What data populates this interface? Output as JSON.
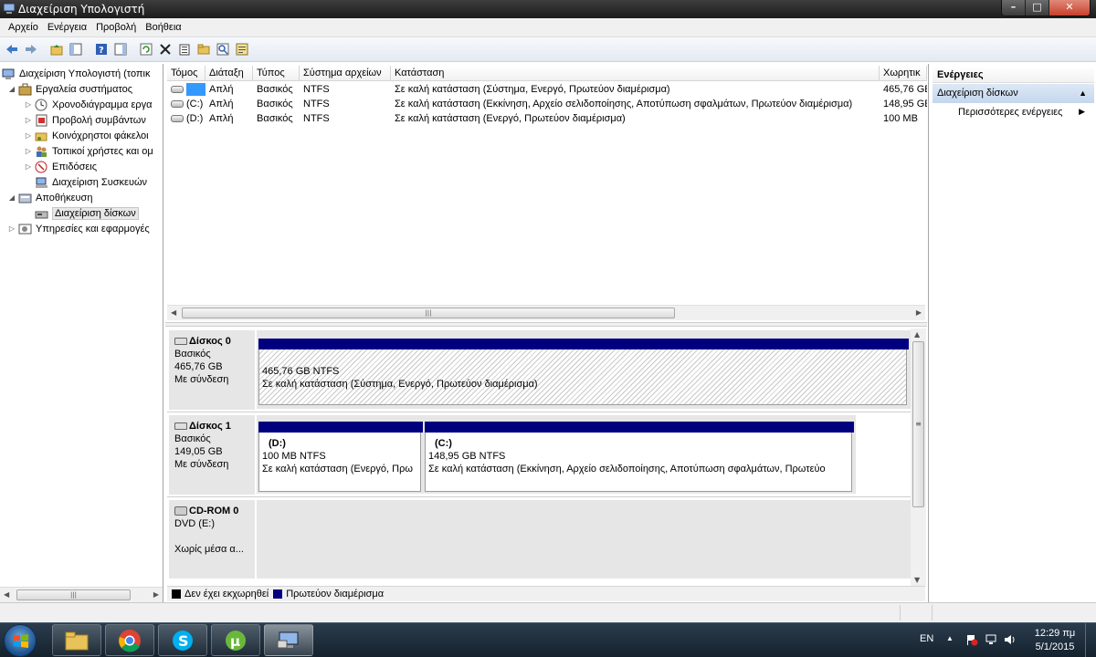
{
  "window": {
    "title": "Διαχείριση Υπολογιστή",
    "min": "–",
    "max": "□",
    "close": "✕"
  },
  "menu": [
    "Αρχείο",
    "Ενέργεια",
    "Προβολή",
    "Βοήθεια"
  ],
  "tree": {
    "root": "Διαχείριση Υπολογιστή (τοπικ",
    "system_tools": "Εργαλεία συστήματος",
    "task_scheduler": "Χρονοδιάγραμμα εργα",
    "event_viewer": "Προβολή συμβάντων",
    "shared_folders": "Κοινόχρηστοι φάκελοι",
    "local_users": "Τοπικοί χρήστες και ομ",
    "performance": "Επιδόσεις",
    "device_manager": "Διαχείριση Συσκευών",
    "storage": "Αποθήκευση",
    "disk_management": "Διαχείριση δίσκων",
    "services": "Υπηρεσίες και εφαρμογές"
  },
  "volume_list": {
    "headers": [
      "Τόμος",
      "Διάταξη",
      "Τύπος",
      "Σύστημα αρχείων",
      "Κατάσταση",
      "Χωρητικ"
    ],
    "rows": [
      {
        "volume": "",
        "layout": "Απλή",
        "type": "Βασικός",
        "fs": "NTFS",
        "status": "Σε καλή κατάσταση (Σύστημα, Ενεργό, Πρωτεύον διαμέρισμα)",
        "capacity": "465,76 GE"
      },
      {
        "volume": "(C:)",
        "layout": "Απλή",
        "type": "Βασικός",
        "fs": "NTFS",
        "status": "Σε καλή κατάσταση (Εκκίνηση, Αρχείο σελιδοποίησης, Αποτύπωση σφαλμάτων, Πρωτεύον διαμέρισμα)",
        "capacity": "148,95 GE"
      },
      {
        "volume": "(D:)",
        "layout": "Απλή",
        "type": "Βασικός",
        "fs": "NTFS",
        "status": "Σε καλή κατάσταση (Ενεργό, Πρωτεύον διαμέρισμα)",
        "capacity": "100 MB"
      }
    ]
  },
  "disks": [
    {
      "name": "Δίσκος 0",
      "type": "Βασικός",
      "size": "465,76 GB",
      "state": "Με σύνδεση",
      "partitions": [
        {
          "label": "",
          "size": "465,76 GB NTFS",
          "status": "Σε καλή κατάσταση (Σύστημα, Ενεργό, Πρωτεύον διαμέρισμα)"
        }
      ]
    },
    {
      "name": "Δίσκος 1",
      "type": "Βασικός",
      "size": "149,05 GB",
      "state": "Με σύνδεση",
      "partitions": [
        {
          "label": "(D:)",
          "size": "100 MB NTFS",
          "status": "Σε καλή κατάσταση (Ενεργό, Πρω"
        },
        {
          "label": "(C:)",
          "size": "148,95 GB NTFS",
          "status": "Σε καλή κατάσταση (Εκκίνηση, Αρχείο σελιδοποίησης, Αποτύπωση σφαλμάτων, Πρωτεύο"
        }
      ]
    },
    {
      "name": "CD-ROM 0",
      "type": "DVD (E:)",
      "size": "",
      "state": "Χωρίς μέσα α..."
    }
  ],
  "legend": {
    "unallocated": "Δεν έχει εκχωρηθεί",
    "primary": "Πρωτεύον διαμέρισμα",
    "unallocated_color": "#000000",
    "primary_color": "#00007f"
  },
  "actions": {
    "header": "Ενέργειες",
    "section": "Διαχείριση δίσκων",
    "more": "Περισσότερες ενέργειες"
  },
  "taskbar": {
    "apps": [
      "explorer",
      "chrome",
      "skype",
      "utorrent",
      "computer-management"
    ],
    "lang": "EN",
    "time": "12:29 πμ",
    "date": "5/1/2015"
  }
}
